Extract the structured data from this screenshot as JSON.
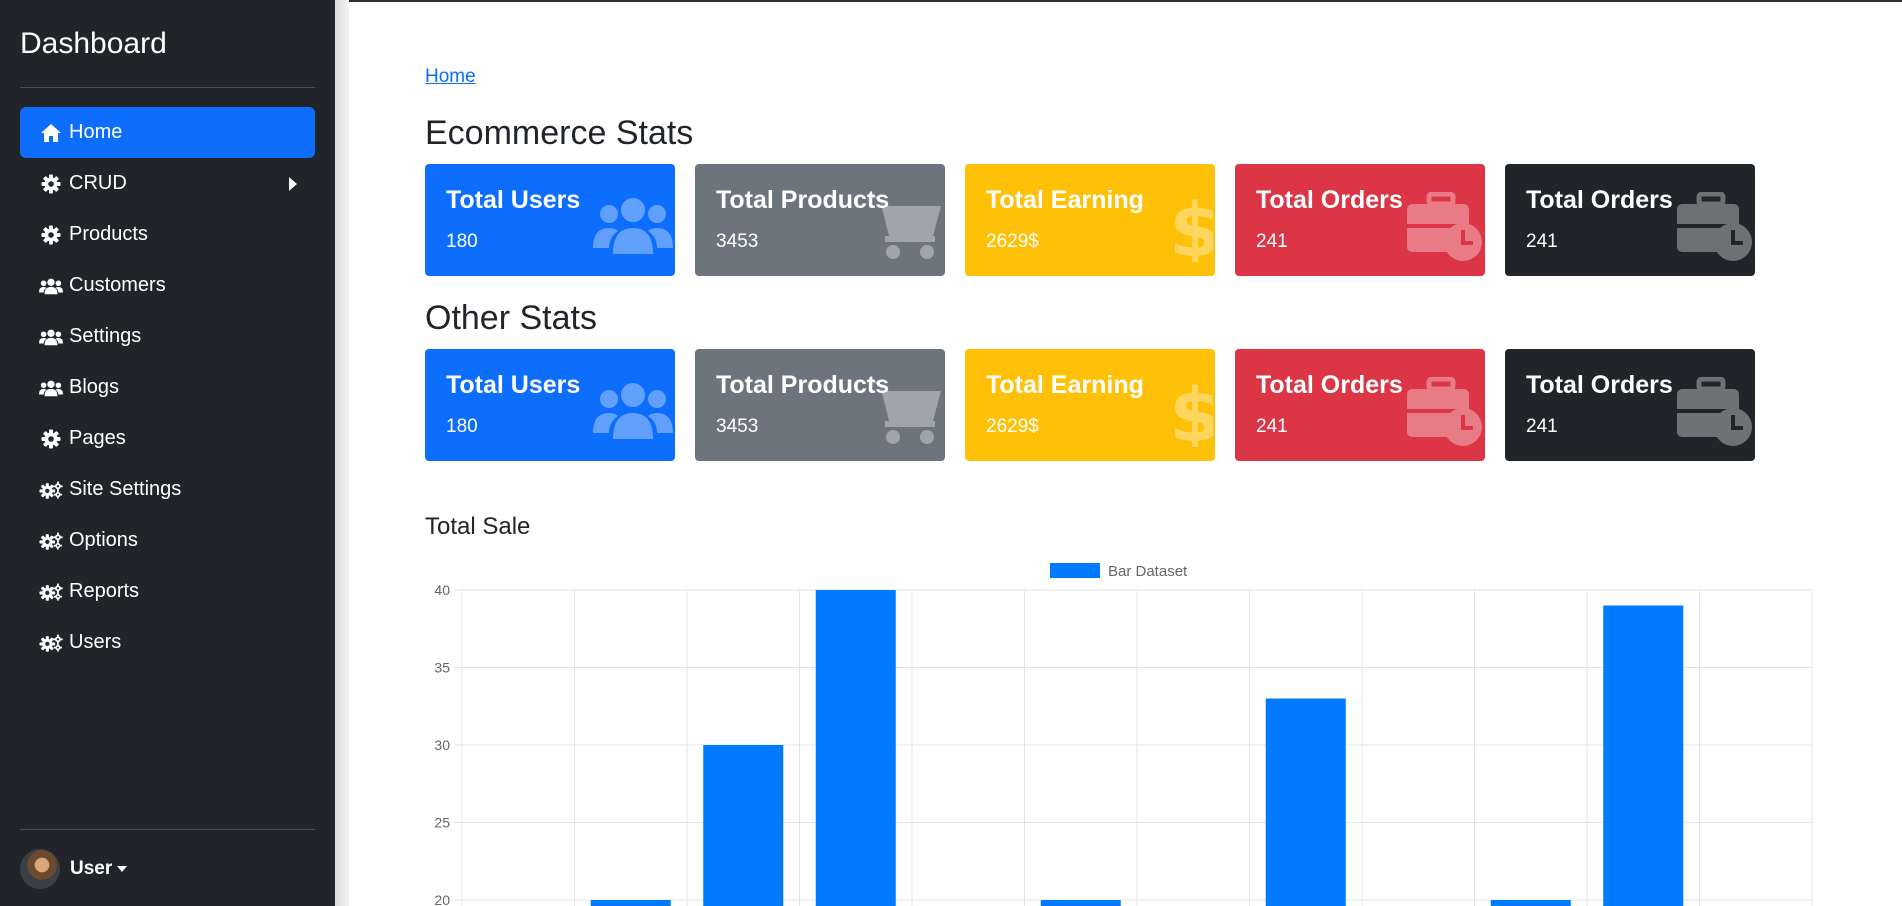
{
  "sidebar": {
    "title": "Dashboard",
    "items": [
      {
        "label": "Home",
        "icon": "home-icon",
        "active": true
      },
      {
        "label": "CRUD",
        "icon": "gear-icon",
        "submenu": true
      },
      {
        "label": "Products",
        "icon": "gear-icon"
      },
      {
        "label": "Customers",
        "icon": "users-icon"
      },
      {
        "label": "Settings",
        "icon": "users-icon"
      },
      {
        "label": "Blogs",
        "icon": "users-icon"
      },
      {
        "label": "Pages",
        "icon": "gear-icon"
      },
      {
        "label": "Site Settings",
        "icon": "gears-icon"
      },
      {
        "label": "Options",
        "icon": "gears-icon"
      },
      {
        "label": "Reports",
        "icon": "gears-icon"
      },
      {
        "label": "Users",
        "icon": "gears-icon"
      }
    ],
    "user": {
      "name": "User"
    }
  },
  "breadcrumb": "Home",
  "ecommerce": {
    "title": "Ecommerce Stats",
    "cards": [
      {
        "title": "Total Users",
        "value": "180",
        "icon": "users-icon",
        "color": "#0d6efd"
      },
      {
        "title": "Total Products",
        "value": "3453",
        "icon": "cart-icon",
        "color": "#6c757d"
      },
      {
        "title": "Total Earning",
        "value": "2629$",
        "icon": "dollar-icon",
        "color": "#ffc107"
      },
      {
        "title": "Total Orders",
        "value": "241",
        "icon": "briefcase-clock-icon",
        "color": "#dc3545"
      },
      {
        "title": "Total Orders",
        "value": "241",
        "icon": "briefcase-clock-icon",
        "color": "#212529"
      }
    ]
  },
  "other": {
    "title": "Other Stats",
    "cards": [
      {
        "title": "Total Users",
        "value": "180",
        "icon": "users-icon",
        "color": "#0d6efd"
      },
      {
        "title": "Total Products",
        "value": "3453",
        "icon": "cart-icon",
        "color": "#6c757d"
      },
      {
        "title": "Total Earning",
        "value": "2629$",
        "icon": "dollar-icon",
        "color": "#ffc107"
      },
      {
        "title": "Total Orders",
        "value": "241",
        "icon": "briefcase-clock-icon",
        "color": "#dc3545"
      },
      {
        "title": "Total Orders",
        "value": "241",
        "icon": "briefcase-clock-icon",
        "color": "#212529"
      }
    ]
  },
  "sale": {
    "title": "Total Sale"
  },
  "chart_data": {
    "type": "bar",
    "legend": [
      "Bar Dataset"
    ],
    "legend_position": "top",
    "series": [
      {
        "name": "Bar Dataset",
        "values": [
          null,
          20,
          30,
          40,
          null,
          20,
          null,
          33,
          null,
          20,
          39,
          null
        ],
        "color": "#007bff"
      }
    ],
    "ylim_visible": [
      20,
      40
    ],
    "yticks": [
      40,
      35,
      30,
      25,
      20
    ],
    "grid": true
  }
}
